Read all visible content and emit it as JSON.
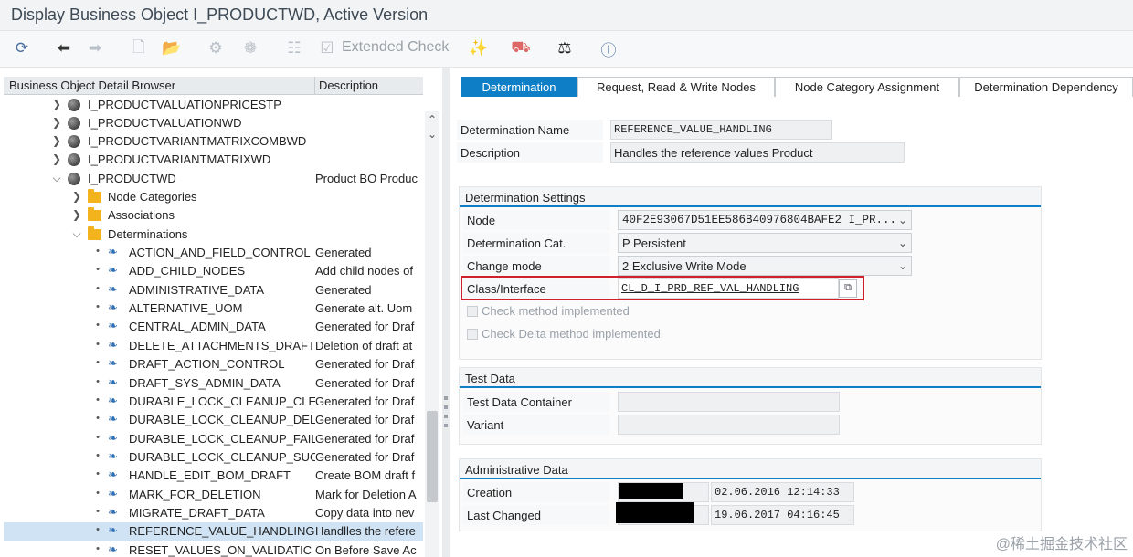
{
  "window": {
    "title": "Display Business Object I_PRODUCTWD, Active Version"
  },
  "toolbar": {
    "extended_check_label": "Extended Check"
  },
  "tree": {
    "header": {
      "col1": "Business Object Detail Browser",
      "col2": "Description"
    },
    "rows": [
      {
        "name": "I_PRODUCTVALUATIONPRICESTP",
        "desc": ""
      },
      {
        "name": "I_PRODUCTVALUATIONWD",
        "desc": ""
      },
      {
        "name": "I_PRODUCTVARIANTMATRIXCOMBWD",
        "desc": ""
      },
      {
        "name": "I_PRODUCTVARIANTMATRIXWD",
        "desc": ""
      },
      {
        "name": "I_PRODUCTWD",
        "desc": "Product BO Produc"
      },
      {
        "name": "Node Categories",
        "desc": ""
      },
      {
        "name": "Associations",
        "desc": ""
      },
      {
        "name": "Determinations",
        "desc": ""
      },
      {
        "name": "ACTION_AND_FIELD_CONTROL",
        "desc": "Generated"
      },
      {
        "name": "ADD_CHILD_NODES",
        "desc": "Add child nodes of"
      },
      {
        "name": "ADMINISTRATIVE_DATA",
        "desc": "Generated"
      },
      {
        "name": "ALTERNATIVE_UOM",
        "desc": "Generate alt. Uom"
      },
      {
        "name": "CENTRAL_ADMIN_DATA",
        "desc": "Generated for Draf"
      },
      {
        "name": "DELETE_ATTACHMENTS_DRAFT",
        "desc": "Deletion of draft at"
      },
      {
        "name": "DRAFT_ACTION_CONTROL",
        "desc": "Generated for Draf"
      },
      {
        "name": "DRAFT_SYS_ADMIN_DATA",
        "desc": "Generated for Draf"
      },
      {
        "name": "DURABLE_LOCK_CLEANUP_CLEA",
        "desc": "Generated for Draf"
      },
      {
        "name": "DURABLE_LOCK_CLEANUP_DELE",
        "desc": "Generated for Draf"
      },
      {
        "name": "DURABLE_LOCK_CLEANUP_FAIL",
        "desc": "Generated for Draf"
      },
      {
        "name": "DURABLE_LOCK_CLEANUP_SUCC",
        "desc": "Generated for Draf"
      },
      {
        "name": "HANDLE_EDIT_BOM_DRAFT",
        "desc": "Create BOM draft f"
      },
      {
        "name": "MARK_FOR_DELETION",
        "desc": "Mark for Deletion A"
      },
      {
        "name": "MIGRATE_DRAFT_DATA",
        "desc": "Copy data into nev"
      },
      {
        "name": "REFERENCE_VALUE_HANDLING",
        "desc": "Handlles the refere"
      },
      {
        "name": "RESET_VALUES_ON_VALIDATIC",
        "desc": "On Before Save Ac"
      }
    ]
  },
  "tabs": [
    "Determination",
    "Request, Read & Write Nodes",
    "Node Category Assignment",
    "Determination Dependency"
  ],
  "determination": {
    "name_label": "Determination Name",
    "name_value": "REFERENCE_VALUE_HANDLING",
    "desc_label": "Description",
    "desc_value": "Handles the reference values Product"
  },
  "settings": {
    "title": "Determination Settings",
    "node_label": "Node",
    "node_value": "40F2E93067D51EE586B40976804BAFE2 I_PR...",
    "cat_label": "Determination Cat.",
    "cat_value": "P Persistent",
    "mode_label": "Change mode",
    "mode_value": "2 Exclusive Write Mode",
    "class_label": "Class/Interface",
    "class_value": "CL_D_I_PRD_REF_VAL_HANDLING",
    "check_method": "Check method implemented",
    "check_delta": "Check Delta method implemented"
  },
  "testdata": {
    "title": "Test Data",
    "container_label": "Test Data Container",
    "variant_label": "Variant"
  },
  "admin": {
    "title": "Administrative Data",
    "creation_label": "Creation",
    "creation_date": "02.06.2016 12:14:33",
    "changed_label": "Last Changed",
    "changed_date": "19.06.2017 04:16:45"
  },
  "watermark": "@稀土掘金技术社区"
}
